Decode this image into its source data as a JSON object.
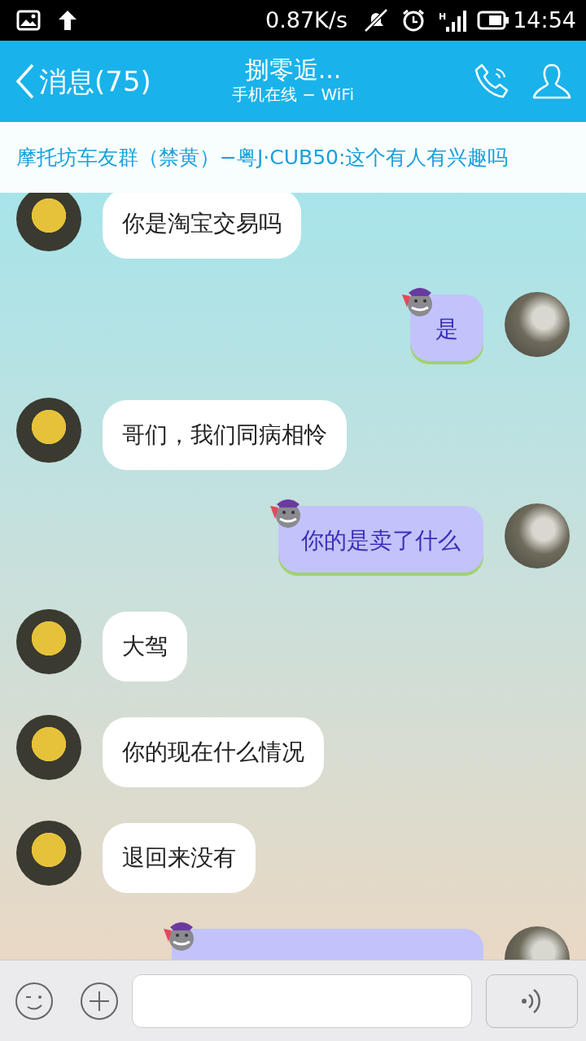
{
  "status_bar": {
    "network_speed": "0.87K/s",
    "signal_type": "H",
    "time": "14:54"
  },
  "header": {
    "back_label": "消息(75)",
    "title": "捌零逅...",
    "subtitle": "手机在线 − WiFi"
  },
  "notice": {
    "text": "摩托坊车友群（禁黄）−粤J·CUB50:这个有人有兴趣吗"
  },
  "messages": [
    {
      "kind": "incoming",
      "text": "你是淘宝交易吗"
    },
    {
      "kind": "outgoing",
      "text": "是"
    },
    {
      "kind": "incoming",
      "text": "哥们，我们同病相怜"
    },
    {
      "kind": "outgoing",
      "text": "你的是卖了什么"
    },
    {
      "kind": "incoming",
      "text": "大驾"
    },
    {
      "kind": "incoming",
      "text": "你的现在什么情况"
    },
    {
      "kind": "incoming",
      "text": "退回来没有"
    },
    {
      "kind": "outgoing"
    }
  ]
}
